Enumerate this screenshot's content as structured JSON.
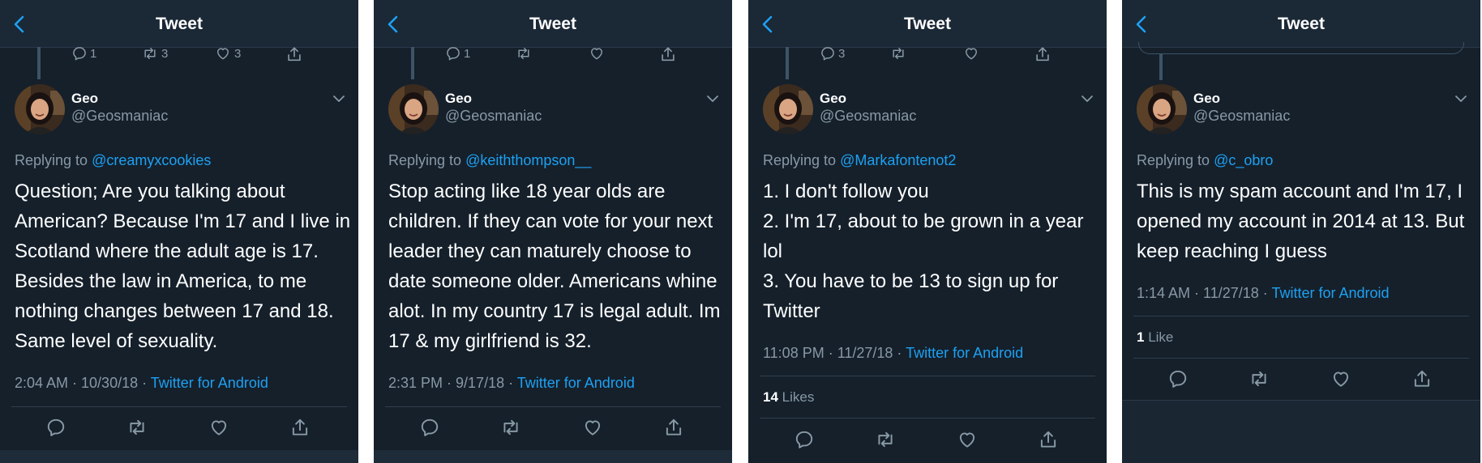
{
  "header_title": "Tweet",
  "author": {
    "name": "Geo",
    "handle": "@Geosmaniac"
  },
  "replying_prefix": "Replying to",
  "panels": [
    {
      "prev_counts": {
        "reply": "1",
        "retweet": "3",
        "like": "3"
      },
      "replying_to": "@creamyxcookies",
      "lines": [
        "Question; Are you talking about",
        "American? Because I'm 17 and I live in",
        "Scotland where the adult age is 17.",
        "Besides the law in America, to me",
        "nothing changes between 17 and 18.",
        "Same level of sexuality."
      ],
      "time": "2:04 AM · 10/30/18 · ",
      "source": "Twitter for Android"
    },
    {
      "prev_counts": {
        "reply": "1",
        "retweet": "",
        "like": ""
      },
      "replying_to": "@keiththompson__",
      "lines": [
        "Stop acting like 18 year olds are",
        "children. If they can vote for your next",
        "leader they can maturely choose to",
        "date someone older. Americans whine",
        "alot. In my country 17 is legal adult. Im",
        "17 & my girlfriend is 32."
      ],
      "time": "2:31 PM · 9/17/18 · ",
      "source": "Twitter for Android"
    },
    {
      "prev_counts": {
        "reply": "3",
        "retweet": "",
        "like": ""
      },
      "replying_to": "@Markafontenot2",
      "lines": [
        "1. I don't follow you",
        "2. I'm 17, about to be grown in a year",
        "lol",
        "3. You have to be 13 to sign up for",
        "Twitter"
      ],
      "time": "11:08 PM · 11/27/18 · ",
      "source": "Twitter for Android",
      "likes_count": "14",
      "likes_label": "Likes"
    },
    {
      "replying_to": "@c_obro",
      "lines": [
        "This is my spam account and I'm 17, I",
        "opened my account in 2014 at 13. But",
        "keep reaching I guess"
      ],
      "time": "1:14 AM · 11/27/18 · ",
      "source": "Twitter for Android",
      "likes_count": "1",
      "likes_label": "Like"
    }
  ],
  "icons": {
    "back": "chevron-left-icon",
    "reply": "reply-icon",
    "retweet": "retweet-icon",
    "like": "heart-icon",
    "share": "share-icon",
    "more": "chevron-down-icon"
  },
  "colors": {
    "background": "#15202b",
    "header": "#1b2836",
    "accent": "#1da1f2",
    "muted": "#8899a6"
  }
}
